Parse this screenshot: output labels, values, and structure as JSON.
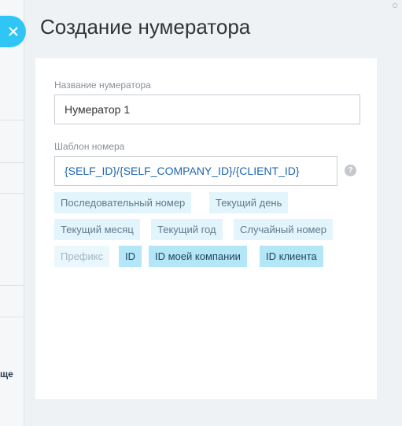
{
  "slider": {
    "title": "Создание нумератора"
  },
  "background": {
    "partial_text": "ще"
  },
  "form": {
    "name_label": "Название нумератора",
    "name_value": "Нумератор 1",
    "template_label": "Шаблон номера",
    "template_value": "{SELF_ID}/{SELF_COMPANY_ID}/{CLIENT_ID}",
    "help_glyph": "?"
  },
  "tags": [
    {
      "label": "Последовательный номер",
      "state": "normal"
    },
    {
      "label": "Текущий день",
      "state": "normal"
    },
    {
      "label": "Текущий месяц",
      "state": "normal"
    },
    {
      "label": "Текущий год",
      "state": "normal"
    },
    {
      "label": "Случайный номер",
      "state": "normal"
    },
    {
      "label": "Префикс",
      "state": "light"
    },
    {
      "label": "ID",
      "state": "active"
    },
    {
      "label": "ID моей компании",
      "state": "active"
    },
    {
      "label": "ID клиента",
      "state": "active"
    }
  ],
  "colors": {
    "accent": "#2fc6f6",
    "template_text": "#2066b0",
    "tag_bg": "#e3f5fc",
    "tag_active_bg": "#b3e6f7"
  }
}
